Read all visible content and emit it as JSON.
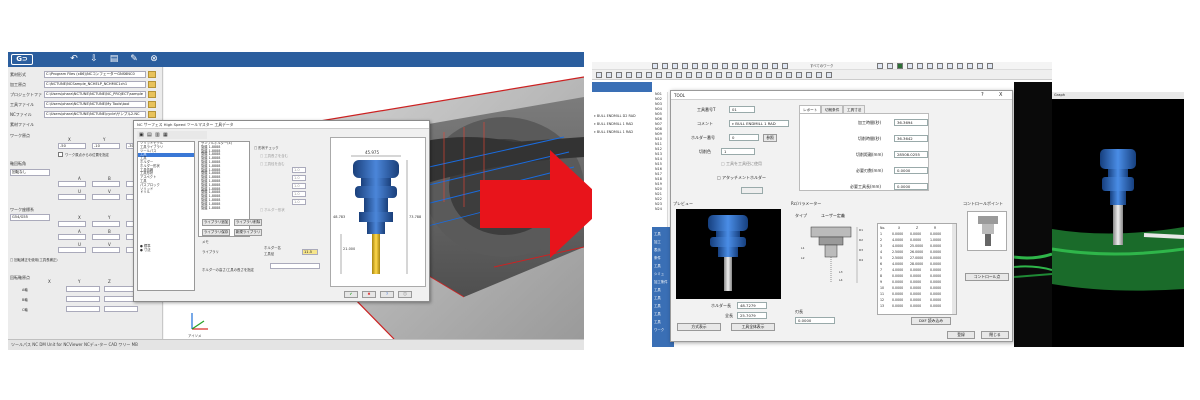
{
  "left_app": {
    "logo": "G⊃",
    "toolbar_icons": [
      "undo-icon",
      "save-icon",
      "clipboard-icon",
      "edit-icon",
      "close-icon"
    ],
    "params": [
      {
        "label": "素材形式",
        "value": "C:\\Program Files (x86)\\NCコンフェーターGNS6NC0"
      },
      {
        "label": "加工原点",
        "value": "C:\\NCTUNE\\NCSample_NCHELP_NCHMIC1ch1"
      },
      {
        "label": "プロジェクトファイル",
        "value": "C:\\Users\\ohara\\NCTUNE\\NCTUNE\\NC_PROJECT\\sample"
      },
      {
        "label": "工具ファイル",
        "value": "C:\\Users\\ohara\\NCTUNE\\NCTUNE\\My Tools\\tool"
      },
      {
        "label": "NCファイル",
        "value": "C:\\Users\\ohara\\NCTUNE\\NCTUNE\\cycle\\サンプル2.NC"
      }
    ],
    "section_blank": "素材ファイル",
    "work_origin": "ワーク原点",
    "xyz_headers": [
      "X",
      "Y",
      "Z"
    ],
    "xyz_values": [
      "-50",
      "-10",
      "-30.4"
    ],
    "check_label": "ワーク原点からの位置を指定",
    "rot_section": "軸回転角",
    "rot_select": "回転なし",
    "abc": [
      "A",
      "B",
      "C"
    ],
    "uvw": [
      "U",
      "V",
      "W"
    ],
    "tool_pos": "ワーク座標系",
    "tool_pos_select": "G54/G55",
    "xyz2": [
      "X",
      "Y",
      "Z"
    ],
    "abc2": [
      "A",
      "B",
      "C"
    ],
    "uvw2": [
      "U",
      "V",
      "W"
    ],
    "check2": "□ 回転補正を使用(工具長補正)",
    "spindle": "回転軸原点",
    "spindle_xyz": [
      "X",
      "Y",
      "Z"
    ],
    "spindle_rows": [
      "A軸",
      "B軸",
      "C軸"
    ],
    "status": "ツールパス  NC DM Unit for NCViewer  NCデュ-ター  CAD ワリー  MB",
    "axis_label": "アイソメ"
  },
  "tool_dialog": {
    "title": "NC サーフェス High Speed ツールマスター  工具データ ",
    "tree_items": [
      "ソリッドモデル",
      "工具ライブラリ",
      "ツールパス",
      "工具",
      "工具",
      "ホルダー",
      "ホルダー形状",
      "工具情報",
      "工具形状",
      "アスペクト",
      "工具",
      "パスブロック",
      "ソリッド",
      "ドリル"
    ],
    "tool_list": [
      "サンプルホルダー(4)",
      "旋盤 1-8888",
      "旋盤 1-8888",
      "旋盤 1-8888",
      "旋盤 1-8888",
      "旋盤 1-8888",
      "旋盤 1-8888",
      "旋盤 1-8888",
      "旋盤 1-8888",
      "旋盤 1-8888",
      "旋盤 1-8888",
      "旋盤 1-8888",
      "旋盤 1-8888",
      "旋盤 1-8888",
      "旋盤 1-8888",
      "旋盤 1-8888",
      "旋盤 1-8888",
      "旋盤 1-8888"
    ],
    "options": [
      "□ 形状チェック",
      "□ 工具長さを含む",
      "□ 工具径を含む",
      "□ ホルダー形状"
    ],
    "option_values": [
      "1.0",
      "1.0",
      "1.0",
      "1.0",
      "1.0"
    ],
    "buttons_row1": [
      "ライブラリ追加",
      "ライブラリ削除"
    ],
    "buttons_row2": [
      "ライブラリ保存",
      "新規ライブラリ"
    ],
    "memo": "メモ",
    "small_labels": [
      "ライブラリ",
      "ホルダー名",
      "工具径"
    ],
    "highlight_value": "11.5",
    "note": "ホルダーの高さ/工具の長さを指定",
    "ok": "✔",
    "cancel": "✖",
    "help": "?",
    "dims": {
      "top": "45.975",
      "left": "48.783",
      "right": "73.788",
      "bottom": "21.000"
    },
    "tree_bottom": [
      "● 標準",
      "● 寸法"
    ]
  },
  "arrow_color": "#e8141b",
  "right_app": {
    "tree_items": [
      "ε BULL ENDMILL D2 RAD",
      "ε BULL ENDMILL 1 RAD",
      "ε BULL ENDMILL 1 RAD"
    ],
    "op_codes": [
      "N01",
      "N02",
      "N03",
      "N04",
      "N05",
      "N06",
      "N07",
      "N08",
      "N09",
      "N10",
      "N11",
      "N12",
      "N13",
      "N14",
      "N15",
      "N16",
      "N17",
      "N18",
      "N19",
      "N20",
      "N21",
      "N22",
      "N23",
      "N24"
    ],
    "blue_items": [
      "工具",
      "加工",
      "表示",
      "条件",
      "工具",
      "シミュ",
      "加工条件",
      "工具",
      "工具",
      "工具",
      "工具",
      "工具",
      "ワーク"
    ],
    "toolbar_text": "すべてのワーク",
    "window_title": "Graph"
  },
  "tool_dialog2": {
    "title": "TOOL",
    "help_btn": "?",
    "close_btn": "X",
    "fields": [
      {
        "label": "工具番号T",
        "value": "01"
      },
      {
        "label": "コメント",
        "value": "ε BULL ENDMILL 1 RAD"
      },
      {
        "label": "ホルダー番号",
        "value": "0"
      },
      {
        "label": "切削色",
        "value": "1"
      }
    ],
    "holder_btn": "参照",
    "check_label": "□ 工具を工具径に使用",
    "check_label2": "□ アタッチメントホルダー",
    "tabs": [
      "レポート",
      "切削条件",
      "工具寸法"
    ],
    "report_rows": [
      {
        "label": "加工時間(秒)",
        "value": "36.3694"
      },
      {
        "label": "切削時間(秒)",
        "value": "36.3642"
      },
      {
        "label": "切削距離(mm)",
        "value": "28508.0255"
      },
      {
        "label": "必要刃数(mm)",
        "value": "0.0000"
      },
      {
        "label": "必要工具長(mm)",
        "value": "0.0000"
      }
    ],
    "preview_label": "プレビュー",
    "rc_label": "Rc/バラメーター",
    "type_label": "タイプ",
    "type_value": "ユーザー定義",
    "control_label": "コントロールポイント",
    "holder_len_label": "ホルダー長",
    "holder_len_value": "48.7279",
    "total_len_label": "全長",
    "total_len_value": "25.7079",
    "btn_front": "方式表示",
    "btn_show": "工具全体表示",
    "blade_label": "刃長",
    "blade_value": "0.0000",
    "dxf_btn": "DXF 読み込み",
    "ctrl_btn": "コントロール点",
    "ok_btn": "登録",
    "close2_btn": "閉じる",
    "table_headers": [
      "No.",
      "X",
      "Z",
      "R"
    ],
    "table_rows": [
      [
        "1",
        "0.0000",
        "0.0000",
        "0.0000"
      ],
      [
        "2",
        "4.0000",
        "0.0000",
        "1.0000"
      ],
      [
        "3",
        "4.0000",
        "25.0000",
        "0.0000"
      ],
      [
        "4",
        "2.5000",
        "26.0000",
        "0.0000"
      ],
      [
        "5",
        "2.5000",
        "27.0000",
        "0.0000"
      ],
      [
        "6",
        "4.0000",
        "28.0000",
        "0.0000"
      ],
      [
        "7",
        "4.0000",
        "0.0000",
        "0.0000"
      ],
      [
        "8",
        "0.0000",
        "0.0000",
        "0.0000"
      ],
      [
        "9",
        "0.0000",
        "0.0000",
        "0.0000"
      ],
      [
        "10",
        "0.0000",
        "0.0000",
        "0.0000"
      ],
      [
        "11",
        "0.0000",
        "0.0000",
        "0.0000"
      ],
      [
        "12",
        "0.0000",
        "0.0000",
        "0.0000"
      ],
      [
        "13",
        "0.0000",
        "0.0000",
        "0.0000"
      ]
    ],
    "dim_labels": [
      "R1",
      "R2",
      "R3",
      "R4",
      "L1",
      "L2",
      "L3",
      "L4"
    ]
  }
}
